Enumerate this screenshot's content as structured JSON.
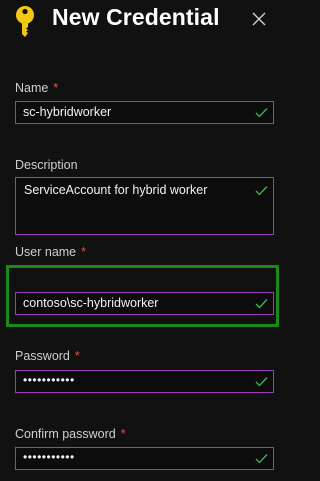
{
  "header": {
    "title": "New Credential",
    "icon": "key-icon",
    "close_icon": "close-icon"
  },
  "colors": {
    "background": "#111111",
    "input_border": "#a23bb6",
    "required_marker": "#e5534b",
    "highlight_border": "#1a8a1a",
    "valid_check": "#3fb950"
  },
  "form": {
    "required_marker": "*",
    "name": {
      "label": "Name",
      "value": "sc-hybridworker"
    },
    "description": {
      "label": "Description",
      "value": "ServiceAccount for hybrid worker"
    },
    "username": {
      "label": "User name",
      "value": "contoso\\sc-hybridworker"
    },
    "password": {
      "label": "Password",
      "value": "•••••••••••"
    },
    "confirm_password": {
      "label": "Confirm password",
      "value": "•••••••••••"
    }
  }
}
